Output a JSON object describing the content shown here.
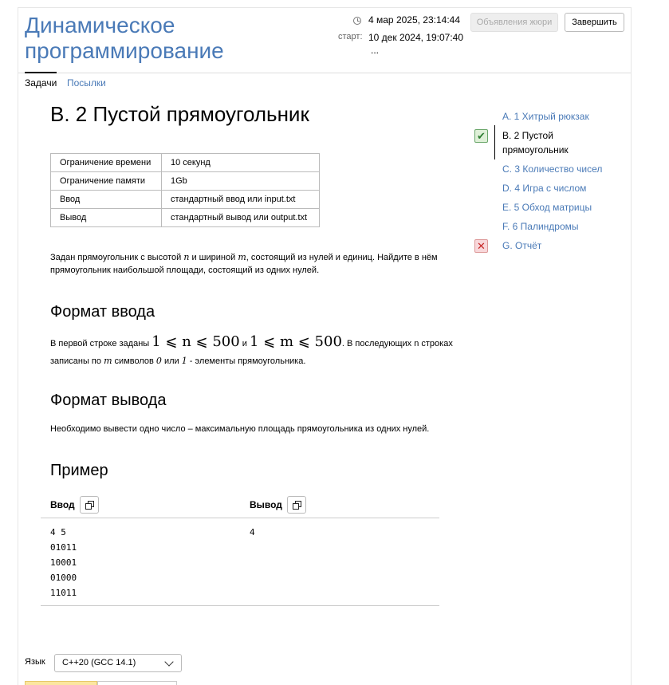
{
  "header": {
    "contest_title": "Динамическое программирование",
    "current_time": "4 мар 2025, 23:14:44",
    "start_label": "старт:",
    "start_time": "10 дек 2024, 19:07:40",
    "ellipsis": "...",
    "jury_button": "Объявления жюри",
    "finish_button": "Завершить"
  },
  "tabs": {
    "tasks": "Задачи",
    "submissions": "Посылки"
  },
  "problem": {
    "title": "B. 2 Пустой прямоугольник",
    "limits": [
      {
        "key": "Ограничение времени",
        "value": "10 секунд"
      },
      {
        "key": "Ограничение памяти",
        "value": "1Gb"
      },
      {
        "key": "Ввод",
        "value": "стандартный ввод или input.txt"
      },
      {
        "key": "Вывод",
        "value": "стандартный вывод или output.txt"
      }
    ],
    "statement_a": "Задан прямоугольник с высотой ",
    "statement_n": "n",
    "statement_b": " и шириной ",
    "statement_m": "m",
    "statement_c": ", состоящий из нулей и единиц. Найдите в нём прямоугольник наибольшой площади, состоящий из одних нулей.",
    "input_heading": "Формат ввода",
    "input_a": "В первой строке заданы ",
    "input_math1": "1 ⩽ n ⩽ 500",
    "input_b": " и ",
    "input_math2": "1 ⩽ m ⩽ 500",
    "input_c": ". В последующих n строках записаны по ",
    "input_m": "m",
    "input_d": " символов ",
    "input_zero": "0",
    "input_e": " или ",
    "input_one": "1",
    "input_f": " - элементы прямоугольника.",
    "output_heading": "Формат вывода",
    "output_text": "Необходимо вывести одно число – максимальную площадь прямоугольника из одних нулей.",
    "example_heading": "Пример",
    "example_input_label": "Ввод",
    "example_output_label": "Вывод",
    "example_input": "4 5\n01011\n10001\n01000\n11011",
    "example_output": "4"
  },
  "sidebar": {
    "items": [
      {
        "label": "A. 1 Хитрый рюкзак",
        "status": ""
      },
      {
        "label": "B. 2 Пустой",
        "label2": "прямоугольник",
        "status": "accepted"
      },
      {
        "label": "C. 3 Количество чисел",
        "status": ""
      },
      {
        "label": "D. 4 Игра с числом",
        "status": ""
      },
      {
        "label": "E. 5 Обход матрицы",
        "status": ""
      },
      {
        "label": "F. 6 Палиндромы",
        "status": ""
      },
      {
        "label": "G. Отчёт",
        "status": "failed"
      }
    ],
    "check_glyph": "✔",
    "cross_glyph": "✕"
  },
  "footer": {
    "language_label": "Язык",
    "language_value": "C++20 (GCC 14.1)"
  },
  "colors": {
    "link": "#4a7ab7",
    "accepted_bg": "#dff0d8",
    "failed_bg": "#f8d7da"
  }
}
